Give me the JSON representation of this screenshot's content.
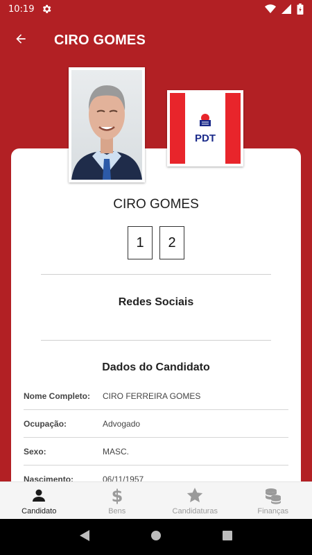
{
  "status_bar": {
    "time": "10:19",
    "icons": [
      "gear-icon",
      "wifi-icon",
      "cellular-icon",
      "battery-icon"
    ]
  },
  "app_bar": {
    "title": "CIRO GOMES",
    "back_icon": "arrow-left-icon"
  },
  "candidate": {
    "name": "CIRO GOMES",
    "number_digits": [
      "1",
      "2"
    ],
    "party_logo_text": "PDT"
  },
  "sections": {
    "social": "Redes Sociais",
    "data": "Dados do Candidato"
  },
  "details": [
    {
      "label": "Nome Completo:",
      "value": "CIRO FERREIRA GOMES"
    },
    {
      "label": "Ocupação:",
      "value": "Advogado"
    },
    {
      "label": "Sexo:",
      "value": "MASC."
    },
    {
      "label": "Nascimento:",
      "value": "06/11/1957"
    }
  ],
  "bottom_nav": [
    {
      "label": "Candidato",
      "icon": "person-icon",
      "active": true
    },
    {
      "label": "Bens",
      "icon": "dollar-icon",
      "active": false
    },
    {
      "label": "Candidaturas",
      "icon": "star-icon",
      "active": false
    },
    {
      "label": "Finanças",
      "icon": "coins-icon",
      "active": false
    }
  ],
  "colors": {
    "primary": "#b22024",
    "card": "#ffffff",
    "nav_active": "#1b1b1b",
    "nav_inactive": "#9a9a9a"
  }
}
